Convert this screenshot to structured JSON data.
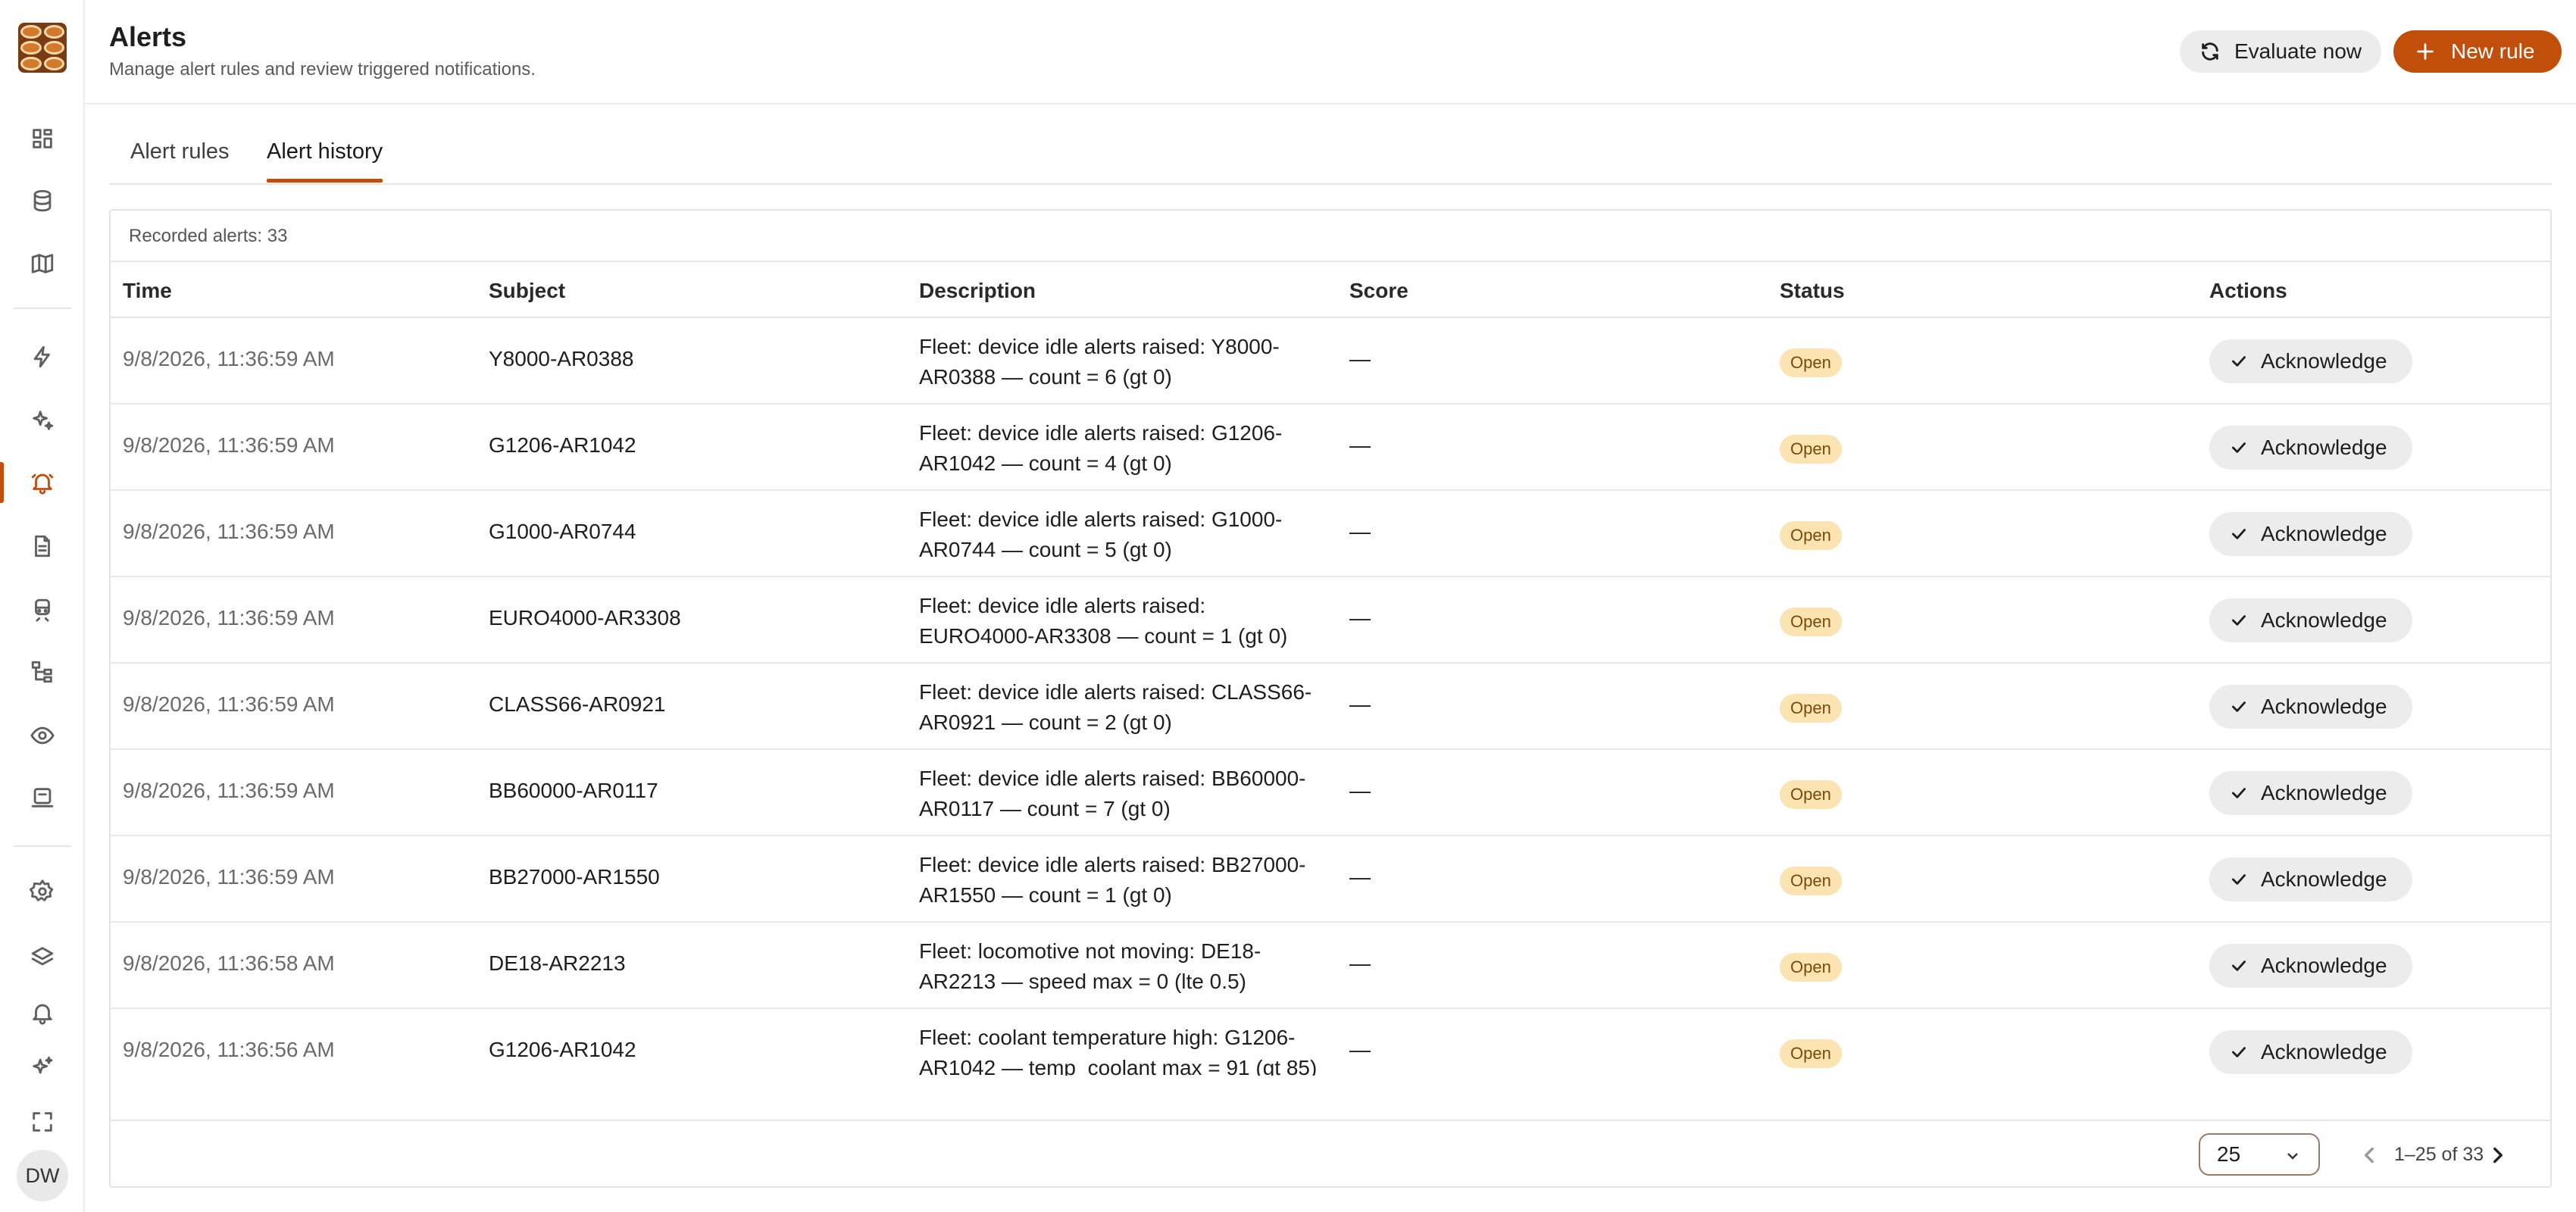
{
  "sidebar": {
    "avatar_initials": "DW",
    "items": [
      {
        "icon": "dashboard-icon"
      },
      {
        "icon": "database-icon"
      },
      {
        "icon": "map-icon"
      },
      {
        "icon": "lightning-icon"
      },
      {
        "icon": "sparkles-icon"
      },
      {
        "icon": "bell-icon",
        "active": true
      },
      {
        "icon": "document-icon"
      },
      {
        "icon": "train-icon"
      },
      {
        "icon": "hierarchy-icon"
      },
      {
        "icon": "eye-icon"
      },
      {
        "icon": "terminal-icon"
      },
      {
        "icon": "gear-icon"
      },
      {
        "icon": "layers-icon"
      },
      {
        "icon": "notification-icon"
      },
      {
        "icon": "stars-icon"
      },
      {
        "icon": "fullscreen-icon"
      }
    ]
  },
  "header": {
    "title": "Alerts",
    "subtitle": "Manage alert rules and review triggered notifications.",
    "evaluate_label": "Evaluate now",
    "new_rule_label": "New rule"
  },
  "tabs": [
    {
      "label": "Alert rules",
      "active": false
    },
    {
      "label": "Alert history",
      "active": true
    }
  ],
  "table": {
    "caption": "Recorded alerts: 33",
    "columns": [
      "Time",
      "Subject",
      "Description",
      "Score",
      "Status",
      "Actions"
    ],
    "rows": [
      {
        "time": "9/8/2026, 11:36:59 AM",
        "subject": "Y8000-AR0388",
        "description": "Fleet: device idle alerts raised: Y8000-AR0388 — count = 6 (gt 0)",
        "score": "—",
        "status": "Open",
        "action": "Acknowledge"
      },
      {
        "time": "9/8/2026, 11:36:59 AM",
        "subject": "G1206-AR1042",
        "description": "Fleet: device idle alerts raised: G1206-AR1042 — count = 4 (gt 0)",
        "score": "—",
        "status": "Open",
        "action": "Acknowledge"
      },
      {
        "time": "9/8/2026, 11:36:59 AM",
        "subject": "G1000-AR0744",
        "description": "Fleet: device idle alerts raised: G1000-AR0744 — count = 5 (gt 0)",
        "score": "—",
        "status": "Open",
        "action": "Acknowledge"
      },
      {
        "time": "9/8/2026, 11:36:59 AM",
        "subject": "EURO4000-AR3308",
        "description": "Fleet: device idle alerts raised: EURO4000-AR3308 — count = 1 (gt 0)",
        "score": "—",
        "status": "Open",
        "action": "Acknowledge"
      },
      {
        "time": "9/8/2026, 11:36:59 AM",
        "subject": "CLASS66-AR0921",
        "description": "Fleet: device idle alerts raised: CLASS66-AR0921 — count = 2 (gt 0)",
        "score": "—",
        "status": "Open",
        "action": "Acknowledge"
      },
      {
        "time": "9/8/2026, 11:36:59 AM",
        "subject": "BB60000-AR0117",
        "description": "Fleet: device idle alerts raised: BB60000-AR0117 — count = 7 (gt 0)",
        "score": "—",
        "status": "Open",
        "action": "Acknowledge"
      },
      {
        "time": "9/8/2026, 11:36:59 AM",
        "subject": "BB27000-AR1550",
        "description": "Fleet: device idle alerts raised: BB27000-AR1550 — count = 1 (gt 0)",
        "score": "—",
        "status": "Open",
        "action": "Acknowledge"
      },
      {
        "time": "9/8/2026, 11:36:58 AM",
        "subject": "DE18-AR2213",
        "description": "Fleet: locomotive not moving: DE18-AR2213 — speed max = 0 (lte 0.5)",
        "score": "—",
        "status": "Open",
        "action": "Acknowledge"
      },
      {
        "time": "9/8/2026, 11:36:56 AM",
        "subject": "G1206-AR1042",
        "description": "Fleet: coolant temperature high: G1206-AR1042 — temp_coolant max = 91 (gt 85)",
        "score": "—",
        "status": "Open",
        "action": "Acknowledge"
      }
    ]
  },
  "pagination": {
    "page_size": "25",
    "range": "1–25 of 33"
  }
}
